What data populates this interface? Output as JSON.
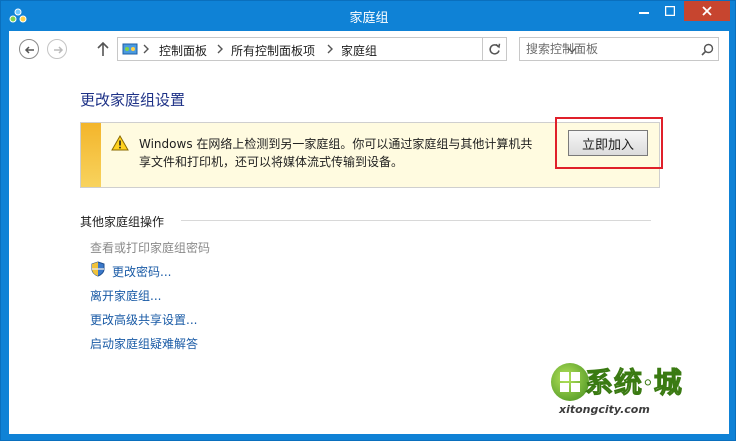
{
  "window": {
    "title": "家庭组",
    "minimize_glyph": "—",
    "maximize_glyph": "□",
    "close_glyph": "✕"
  },
  "navigation": {
    "breadcrumb": [
      "控制面板",
      "所有控制面板项",
      "家庭组"
    ],
    "search_placeholder": "搜索控制面板"
  },
  "main": {
    "heading": "更改家庭组设置",
    "info_bar": {
      "message_line1": "Windows 在网络上检测到另一家庭组。你可以通过家庭组与其他计算机共",
      "message_line2": "享文件和打印机，还可以将媒体流式传输到设备。",
      "join_button": "立即加入",
      "highlight_color": "#e0202a"
    },
    "other_actions": {
      "title": "其他家庭组操作",
      "items": [
        {
          "label": "查看或打印家庭组密码",
          "enabled": false,
          "icon": null
        },
        {
          "label": "更改密码...",
          "enabled": true,
          "icon": "shield-icon"
        },
        {
          "label": "离开家庭组...",
          "enabled": true,
          "icon": null
        },
        {
          "label": "更改高级共享设置...",
          "enabled": true,
          "icon": null
        },
        {
          "label": "启动家庭组疑难解答",
          "enabled": true,
          "icon": null
        }
      ]
    }
  },
  "watermark": {
    "title": "系统·城",
    "subtitle": "xitongcity.com"
  },
  "colors": {
    "titlebar": "#0f82d6",
    "link": "#1a5ba6",
    "heading": "#1e3287",
    "close_button": "#c7452f"
  }
}
